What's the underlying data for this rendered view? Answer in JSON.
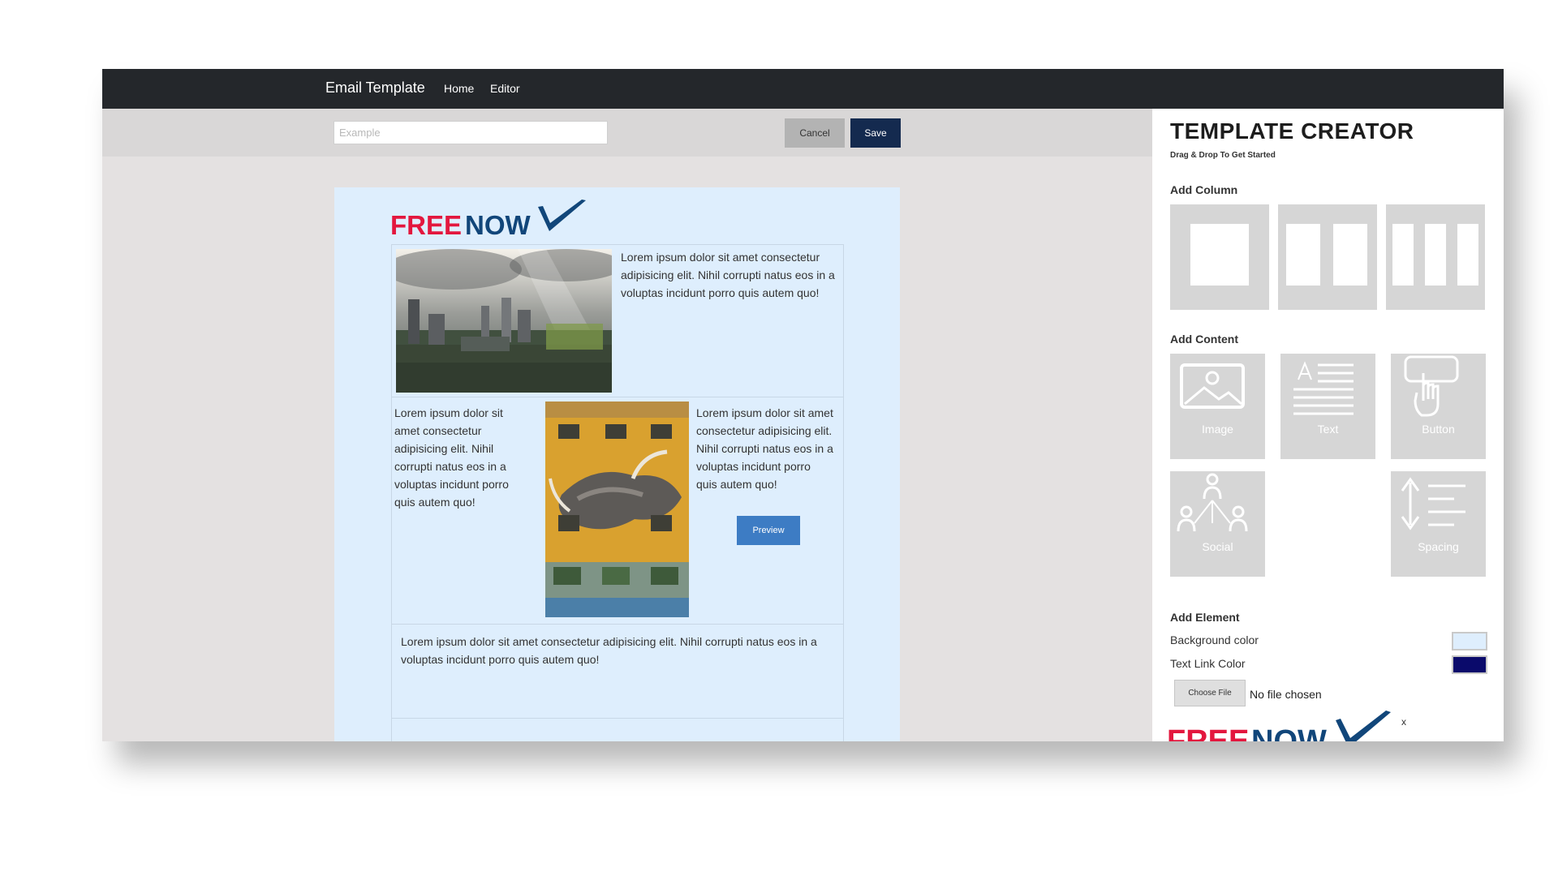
{
  "navbar": {
    "brand": "Email Template",
    "links": [
      "Home",
      "Editor"
    ]
  },
  "toolbar": {
    "name_placeholder": "Example",
    "cancel_label": "Cancel",
    "save_label": "Save"
  },
  "email": {
    "logo": {
      "part1": "FREE",
      "part2": "NOW",
      "color1": "#e3173e",
      "color2": "#11467a"
    },
    "section1_text": "Lorem ipsum dolor sit amet consectetur adipisicing elit. Nihil corrupti natus eos in a voluptas incidunt porro quis autem quo!",
    "section2_left_text": "Lorem ipsum dolor sit amet consectetur adipisicing elit. Nihil corrupti natus eos in a voluptas incidunt porro quis autem quo!",
    "section2_right_text": "Lorem ipsum dolor sit amet consectetur adipisicing elit. Nihil corrupti natus eos in a voluptas incidunt porro quis autem quo!",
    "preview_label": "Preview",
    "section3_text": "Lorem ipsum dolor sit amet consectetur adipisicing elit. Nihil corrupti natus eos in a voluptas incidunt porro quis autem quo!"
  },
  "panel": {
    "title": "TEMPLATE CREATOR",
    "subtitle": "Drag & Drop To Get Started",
    "add_column_label": "Add Column",
    "add_content_label": "Add Content",
    "content_tiles": [
      "Image",
      "Text",
      "Button",
      "Social",
      "Spacing"
    ],
    "add_element_label": "Add Element",
    "background_color_label": "Background color",
    "background_color": "#deeefd",
    "text_link_color_label": "Text Link Color",
    "text_link_color": "#0a0a6b",
    "choose_file_label": "Choose File",
    "file_status": "No file chosen",
    "close_label": "x"
  },
  "colors": {
    "navbar": "#24272b",
    "save_button": "#142a4f",
    "preview_button": "#3d7cc4",
    "tile": "#d6d6d6"
  }
}
